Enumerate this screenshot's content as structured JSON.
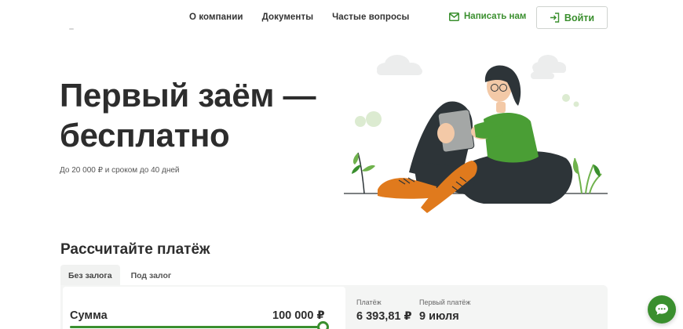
{
  "header": {
    "nav": [
      "О компании",
      "Документы",
      "Частые вопросы"
    ],
    "write_label": "Написать нам",
    "login_label": "Войти"
  },
  "hero": {
    "title_line1": "Первый заём —",
    "title_line2": "бесплатно",
    "subtitle": "До 20 000 ₽ и сроком до 40 дней"
  },
  "calculator": {
    "title": "Рассчитайте платёж",
    "tabs": [
      "Без залога",
      "Под залог"
    ],
    "active_tab": 0,
    "sum_label": "Сумма",
    "sum_value": "100 000 ₽",
    "slider_fraction": 1.0,
    "payment_label": "Платёж",
    "payment_value": "6 393,81 ₽",
    "first_payment_label": "Первый платёж",
    "first_payment_value": "9 июля"
  },
  "colors": {
    "accent": "#3a8f2e",
    "text": "#2d2d2d",
    "card_bg": "#f4f5f4"
  },
  "icons": {
    "write": "mail-icon",
    "login": "login-arrow-icon",
    "chat": "chat-bubble-icon"
  }
}
